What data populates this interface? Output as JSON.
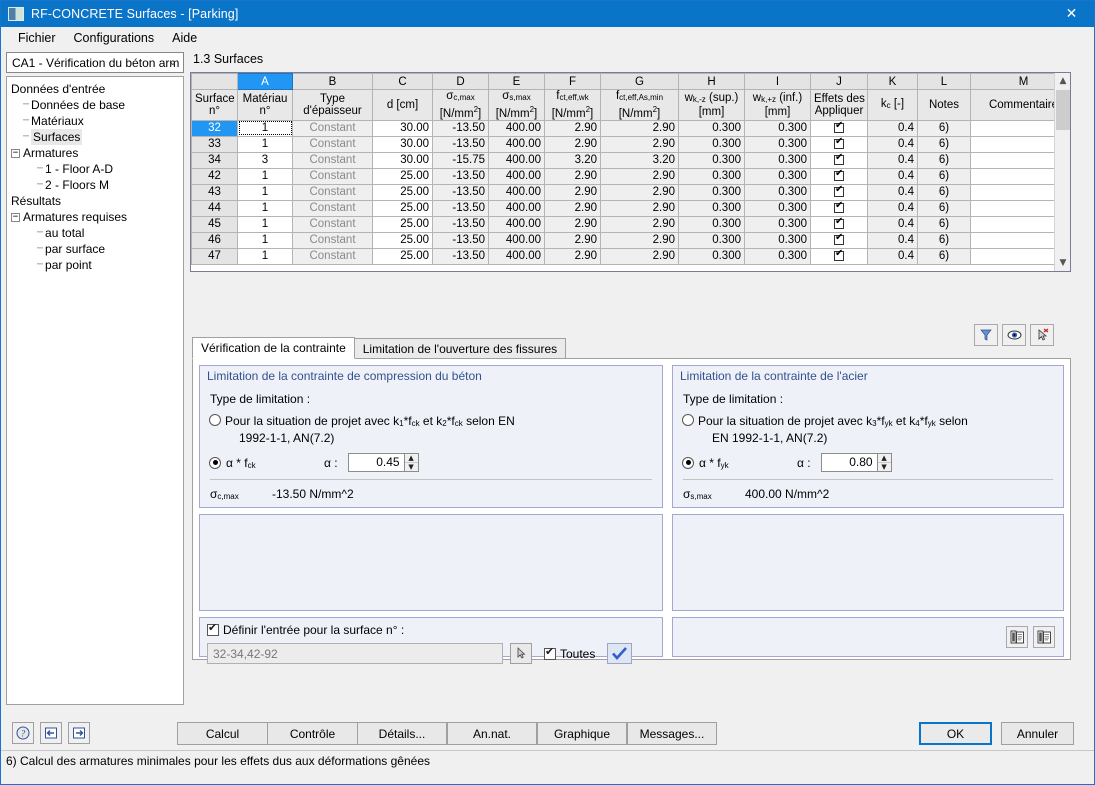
{
  "window": {
    "title": "RF-CONCRETE Surfaces - [Parking]",
    "close_label": "✕",
    "app_icon": "app-window-icon"
  },
  "menu": [
    "Fichier",
    "Configurations",
    "Aide"
  ],
  "sidebar": {
    "combo_value": "CA1 - Vérification du béton arm",
    "combo_arrow": "⌄",
    "items": [
      {
        "label": "Données d'entrée",
        "indent": 0,
        "dash": false,
        "expander": "",
        "selected": false
      },
      {
        "label": "Données de base",
        "indent": 1,
        "dash": true,
        "expander": "",
        "selected": false
      },
      {
        "label": "Matériaux",
        "indent": 1,
        "dash": true,
        "expander": "",
        "selected": false
      },
      {
        "label": "Surfaces",
        "indent": 1,
        "dash": true,
        "expander": "",
        "selected": true
      },
      {
        "label": "Armatures",
        "indent": 0,
        "dash": true,
        "expander": "−",
        "selected": false
      },
      {
        "label": "1 - Floor A-D",
        "indent": 2,
        "dash": true,
        "expander": "",
        "selected": false
      },
      {
        "label": "2 - Floors M",
        "indent": 2,
        "dash": true,
        "expander": "",
        "selected": false
      },
      {
        "label": "Résultats",
        "indent": 0,
        "dash": false,
        "expander": "",
        "selected": false
      },
      {
        "label": "Armatures requises",
        "indent": 0,
        "dash": true,
        "expander": "−",
        "selected": false
      },
      {
        "label": "au total",
        "indent": 2,
        "dash": true,
        "expander": "",
        "selected": false
      },
      {
        "label": "par surface",
        "indent": 2,
        "dash": true,
        "expander": "",
        "selected": false
      },
      {
        "label": "par point",
        "indent": 2,
        "dash": true,
        "expander": "",
        "selected": false
      }
    ]
  },
  "section": {
    "title": "1.3 Surfaces"
  },
  "table": {
    "column_letters": [
      "",
      "A",
      "B",
      "C",
      "D",
      "E",
      "F",
      "G",
      "H",
      "I",
      "J",
      "K",
      "L",
      "M"
    ],
    "active_column": "A",
    "headers": [
      {
        "l1": "Surface",
        "l2": "",
        "l3": "n°"
      },
      {
        "l1": "Matériau",
        "l2": "",
        "l3": "n°"
      },
      {
        "l1": "Type",
        "l2": "",
        "l3": "d'épaisseur"
      },
      {
        "l1": "",
        "l2": "",
        "l3": "d [cm]"
      },
      {
        "l1": "",
        "l2": "σc,max",
        "l3": "[N/mm2]"
      },
      {
        "l1": "",
        "l2": "σs,max",
        "l3": "[N/mm2]"
      },
      {
        "l1": "",
        "l2": "fct,eff,wk",
        "l3": "[N/mm2]"
      },
      {
        "l1": "",
        "l2": "fct,eff,As,min",
        "l3": "[N/mm2]"
      },
      {
        "l1": "",
        "l2": "wk,-z (sup.)",
        "l3": "[mm]"
      },
      {
        "l1": "",
        "l2": "wk,+z (inf.)",
        "l3": "[mm]"
      },
      {
        "l1": "Effets des déf.gênées",
        "l2": "",
        "l3": "Appliquer"
      },
      {
        "l1": "",
        "l2": "",
        "l3": "kc [-]"
      },
      {
        "l1": "",
        "l2": "",
        "l3": "Notes"
      },
      {
        "l1": "",
        "l2": "",
        "l3": "Commentaire"
      }
    ],
    "rows": [
      {
        "surface": "32",
        "materiau": "1",
        "type": "Constant",
        "d": "30.00",
        "sc_max": "-13.50",
        "ss_max": "400.00",
        "fct_wk": "2.90",
        "fct_as": "2.90",
        "wk_sup": "0.300",
        "wk_inf": "0.300",
        "appliquer": true,
        "kc": "0.4",
        "notes": "6)",
        "commentaire": "",
        "selected": true
      },
      {
        "surface": "33",
        "materiau": "1",
        "type": "Constant",
        "d": "30.00",
        "sc_max": "-13.50",
        "ss_max": "400.00",
        "fct_wk": "2.90",
        "fct_as": "2.90",
        "wk_sup": "0.300",
        "wk_inf": "0.300",
        "appliquer": true,
        "kc": "0.4",
        "notes": "6)",
        "commentaire": "",
        "selected": false
      },
      {
        "surface": "34",
        "materiau": "3",
        "type": "Constant",
        "d": "30.00",
        "sc_max": "-15.75",
        "ss_max": "400.00",
        "fct_wk": "3.20",
        "fct_as": "3.20",
        "wk_sup": "0.300",
        "wk_inf": "0.300",
        "appliquer": true,
        "kc": "0.4",
        "notes": "6)",
        "commentaire": "",
        "selected": false
      },
      {
        "surface": "42",
        "materiau": "1",
        "type": "Constant",
        "d": "25.00",
        "sc_max": "-13.50",
        "ss_max": "400.00",
        "fct_wk": "2.90",
        "fct_as": "2.90",
        "wk_sup": "0.300",
        "wk_inf": "0.300",
        "appliquer": true,
        "kc": "0.4",
        "notes": "6)",
        "commentaire": "",
        "selected": false
      },
      {
        "surface": "43",
        "materiau": "1",
        "type": "Constant",
        "d": "25.00",
        "sc_max": "-13.50",
        "ss_max": "400.00",
        "fct_wk": "2.90",
        "fct_as": "2.90",
        "wk_sup": "0.300",
        "wk_inf": "0.300",
        "appliquer": true,
        "kc": "0.4",
        "notes": "6)",
        "commentaire": "",
        "selected": false
      },
      {
        "surface": "44",
        "materiau": "1",
        "type": "Constant",
        "d": "25.00",
        "sc_max": "-13.50",
        "ss_max": "400.00",
        "fct_wk": "2.90",
        "fct_as": "2.90",
        "wk_sup": "0.300",
        "wk_inf": "0.300",
        "appliquer": true,
        "kc": "0.4",
        "notes": "6)",
        "commentaire": "",
        "selected": false
      },
      {
        "surface": "45",
        "materiau": "1",
        "type": "Constant",
        "d": "25.00",
        "sc_max": "-13.50",
        "ss_max": "400.00",
        "fct_wk": "2.90",
        "fct_as": "2.90",
        "wk_sup": "0.300",
        "wk_inf": "0.300",
        "appliquer": true,
        "kc": "0.4",
        "notes": "6)",
        "commentaire": "",
        "selected": false
      },
      {
        "surface": "46",
        "materiau": "1",
        "type": "Constant",
        "d": "25.00",
        "sc_max": "-13.50",
        "ss_max": "400.00",
        "fct_wk": "2.90",
        "fct_as": "2.90",
        "wk_sup": "0.300",
        "wk_inf": "0.300",
        "appliquer": true,
        "kc": "0.4",
        "notes": "6)",
        "commentaire": "",
        "selected": false
      },
      {
        "surface": "47",
        "materiau": "1",
        "type": "Constant",
        "d": "25.00",
        "sc_max": "-13.50",
        "ss_max": "400.00",
        "fct_wk": "2.90",
        "fct_as": "2.90",
        "wk_sup": "0.300",
        "wk_inf": "0.300",
        "appliquer": true,
        "kc": "0.4",
        "notes": "6)",
        "commentaire": "",
        "selected": false
      }
    ],
    "toolbar": [
      {
        "name": "filter-icon"
      },
      {
        "name": "eye-visibility-icon"
      },
      {
        "name": "pick-cursor-icon"
      }
    ]
  },
  "tabs": [
    {
      "label": "Vérification de la contrainte",
      "active": true
    },
    {
      "label": "Limitation de l'ouverture des fissures",
      "active": false
    }
  ],
  "concrete_group": {
    "title": "Limitation de la contrainte de compression du béton",
    "type_label": "Type de limitation :",
    "option1_line1": "Pour la situation de projet avec k1*fck et k2*fck selon EN",
    "option1_line2": "1992-1-1, AN(7.2)",
    "option1_selected": false,
    "option2_label": "α * fck",
    "option2_selected": true,
    "alpha_label": "α :",
    "alpha_value": "0.45",
    "result_label": "σc,max",
    "result_value": "-13.50 N/mm^2"
  },
  "steel_group": {
    "title": "Limitation de la contrainte de l'acier",
    "type_label": "Type de limitation :",
    "option1_line1": "Pour la situation de projet avec k3*fyk et k4*fyk selon",
    "option1_line2": "EN 1992-1-1, AN(7.2)",
    "option1_selected": false,
    "option2_label": "α * fyk",
    "option2_selected": true,
    "alpha_label": "α :",
    "alpha_value": "0.80",
    "result_label": "σs,max",
    "result_value": "400.00 N/mm^2"
  },
  "apply_panel": {
    "checkbox_label": "Définir l'entrée pour la surface n° :",
    "checkbox_checked": true,
    "input_value": "32-34,42-92",
    "pick_icon": "pick-cursor-icon",
    "toutes_label": "Toutes",
    "toutes_checked": true,
    "apply_icon": "blue-check-icon"
  },
  "right_panel_tools": [
    {
      "name": "copy-left-icon"
    },
    {
      "name": "copy-right-icon"
    }
  ],
  "footer": {
    "icon_buttons": [
      {
        "name": "help-icon"
      },
      {
        "name": "previous-nav-icon"
      },
      {
        "name": "next-nav-icon"
      }
    ],
    "buttons": [
      "Calcul",
      "Contrôle",
      "Détails...",
      "An.nat.",
      "Graphique",
      "Messages..."
    ],
    "ok_label": "OK",
    "cancel_label": "Annuler"
  },
  "statusbar": {
    "text": "6) Calcul des armatures minimales pour les effets dus aux déformations gênées"
  },
  "colors": {
    "titlebar": "#0a74c8",
    "accent": "#2196f3",
    "group_border": "#a6a6d2",
    "group_bg": "#eef1f8"
  }
}
